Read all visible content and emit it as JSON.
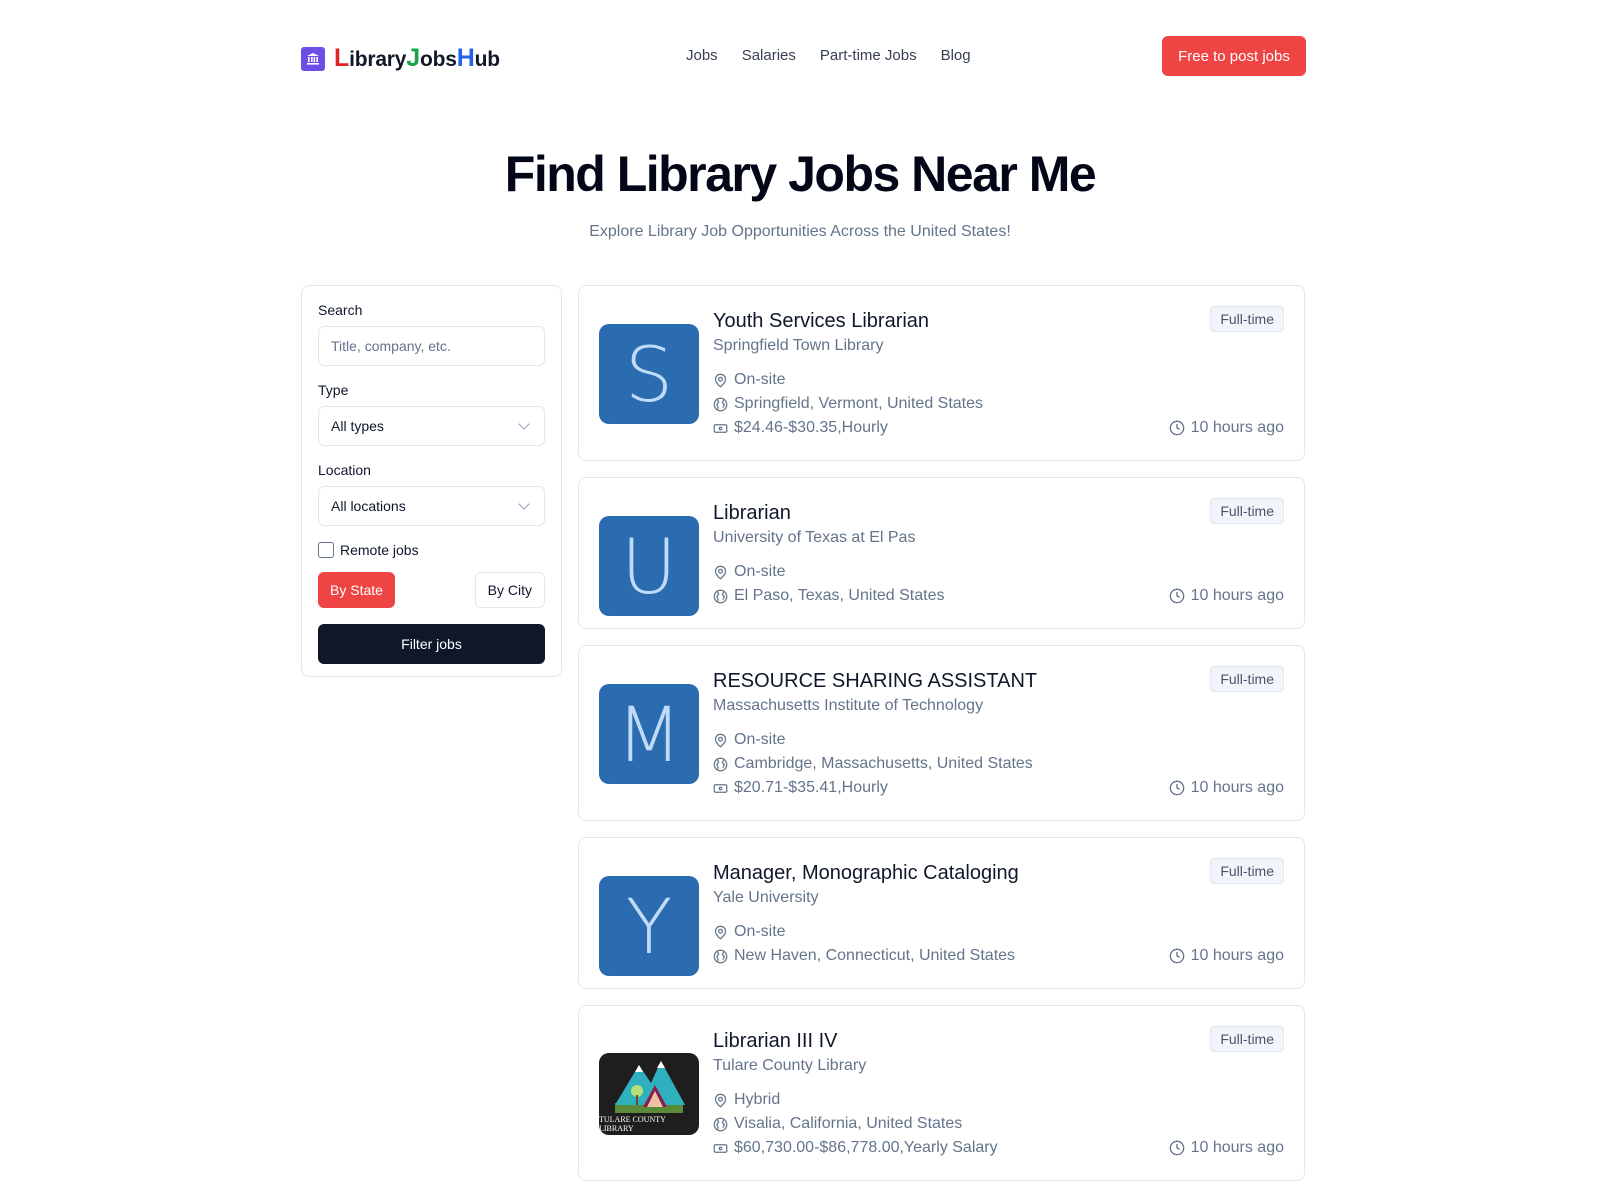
{
  "header": {
    "logo": {
      "icon": "library-building-icon",
      "parts": [
        "L",
        "ibrary",
        "J",
        "obs",
        "H",
        "ub"
      ]
    },
    "nav": [
      "Jobs",
      "Salaries",
      "Part-time Jobs",
      "Blog"
    ],
    "post_button": "Free to post jobs"
  },
  "hero": {
    "title": "Find Library Jobs Near Me",
    "subtitle": "Explore Library Job Opportunities Across the United States!"
  },
  "filters": {
    "search_label": "Search",
    "search_placeholder": "Title, company, etc.",
    "search_value": "",
    "type_label": "Type",
    "type_value": "All types",
    "location_label": "Location",
    "location_value": "All locations",
    "remote_label": "Remote jobs",
    "remote_checked": false,
    "by_state": "By State",
    "by_city": "By City",
    "filter_button": "Filter jobs"
  },
  "jobs": [
    {
      "title": "Youth Services Librarian",
      "company": "Springfield Town Library",
      "logo_letter": "S",
      "workplace": "On-site",
      "location": "Springfield, Vermont, United States",
      "salary": "$24.46-$30.35,Hourly",
      "type": "Full-time",
      "posted": "10 hours ago"
    },
    {
      "title": "Librarian",
      "company": "University of Texas at El Pas",
      "logo_letter": "U",
      "workplace": "On-site",
      "location": "El Paso, Texas, United States",
      "salary": null,
      "type": "Full-time",
      "posted": "10 hours ago"
    },
    {
      "title": "RESOURCE SHARING ASSISTANT",
      "company": "Massachusetts Institute of Technology",
      "logo_letter": "M",
      "workplace": "On-site",
      "location": "Cambridge, Massachusetts, United States",
      "salary": "$20.71-$35.41,Hourly",
      "type": "Full-time",
      "posted": "10 hours ago"
    },
    {
      "title": "Manager, Monographic Cataloging",
      "company": "Yale University",
      "logo_letter": "Y",
      "workplace": "On-site",
      "location": "New Haven, Connecticut, United States",
      "salary": null,
      "type": "Full-time",
      "posted": "10 hours ago"
    },
    {
      "title": "Librarian III IV",
      "company": "Tulare County Library",
      "logo_letter": null,
      "logo_caption": "TULARE COUNTY LIBRARY",
      "workplace": "Hybrid",
      "location": "Visalia, California, United States",
      "salary": "$60,730.00-$86,778.00,Yearly Salary",
      "type": "Full-time",
      "posted": "10 hours ago"
    }
  ],
  "colors": {
    "accent": "#ef4444",
    "dark": "#0f172a",
    "logo_purple": "#6d4ee6",
    "avatar_blue": "#2b6cb0"
  }
}
